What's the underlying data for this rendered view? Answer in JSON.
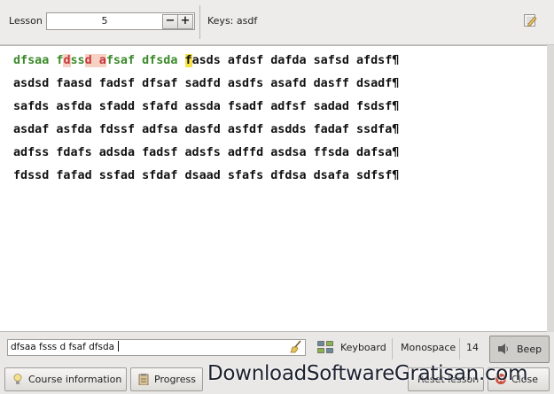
{
  "toolbar": {
    "lesson_label": "Lesson",
    "lesson_value": "5",
    "minus_label": "−",
    "plus_label": "+",
    "keys_label": "Keys: asdf"
  },
  "text": {
    "lines": [
      "dfsaa fdssd afsaf dfsda fasds afdsf dafda safsd afdsf¶",
      "asdsd faasd fadsf dfsaf sadfd asdfs asafd dasff dsadf¶",
      "safds asfda sfadd sfafd assda fsadf adfsf sadad fsdsf¶",
      "asdaf asfda fdssf adfsa dasfd asfdf asdds fadaf ssdfa¶",
      "adfss fdafs adsda fadsf adsfs adffd asdsa ffsda dafsa¶",
      "fdssd fafad ssfad sfdaf dsaad sfafs dfdsa dsafa sdfsf¶"
    ]
  },
  "input": {
    "value": "dfsaa fsss d fsaf dfsda "
  },
  "statusbar": {
    "keyboard_label": "Keyboard",
    "font_label": "Monospace",
    "font_size": "14",
    "beep_label": "Beep"
  },
  "buttons": {
    "course_info": "Course information",
    "progress": "Progress",
    "reset_lesson": "Reset lesson",
    "close": "Close"
  },
  "watermark": "DownloadSoftwareGratisan.com",
  "colors": {
    "correct": "#3a8a2a",
    "error": "#c9353a",
    "error_bg": "#f6d2c4",
    "cursor": "#f7e24a"
  }
}
